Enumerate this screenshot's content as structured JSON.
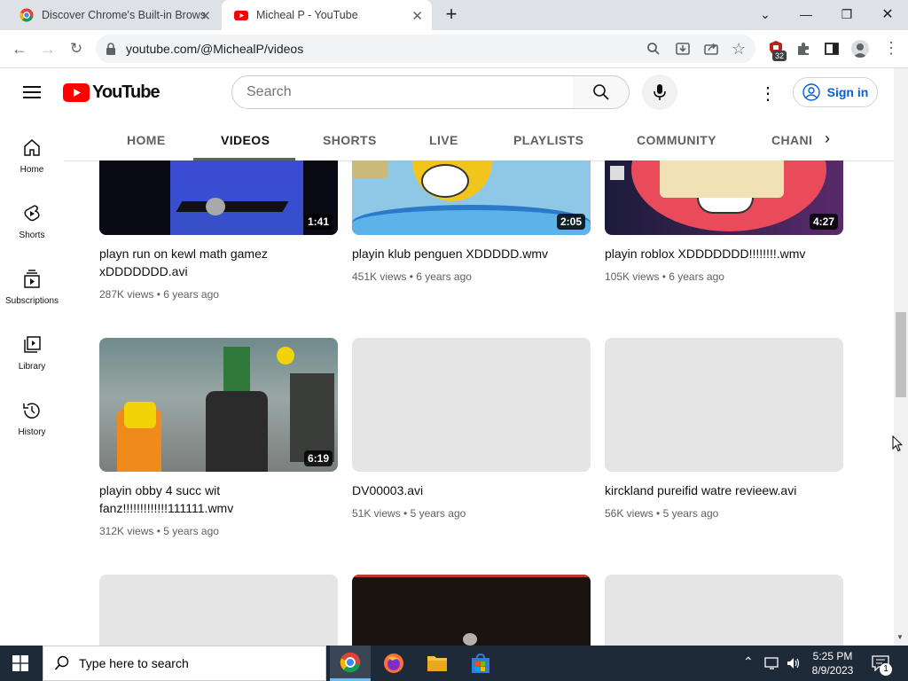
{
  "browser": {
    "tabs": [
      {
        "title": "Discover Chrome's Built-in Brows"
      },
      {
        "title": "Micheal P - YouTube"
      }
    ],
    "url": "youtube.com/@MichealP/videos",
    "extension_badge": "32"
  },
  "youtube": {
    "logo_text": "YouTube",
    "search_placeholder": "Search",
    "signin_label": "Sign in",
    "channel_tabs": [
      "HOME",
      "VIDEOS",
      "SHORTS",
      "LIVE",
      "PLAYLISTS",
      "COMMUNITY",
      "CHANI"
    ],
    "nav": [
      {
        "label": "Home",
        "icon": "home-icon"
      },
      {
        "label": "Shorts",
        "icon": "shorts-icon"
      },
      {
        "label": "Subscriptions",
        "icon": "subscriptions-icon"
      },
      {
        "label": "Library",
        "icon": "library-icon"
      },
      {
        "label": "History",
        "icon": "history-icon"
      }
    ],
    "videos": [
      {
        "title": "playn run on kewl math gamez xDDDDDDD.avi",
        "views": "287K views",
        "age": "6 years ago",
        "duration": "1:41"
      },
      {
        "title": "playin klub penguen XDDDDD.wmv",
        "views": "451K views",
        "age": "6 years ago",
        "duration": "2:05"
      },
      {
        "title": "playin roblox XDDDDDDD!!!!!!!!.wmv",
        "views": "105K views",
        "age": "6 years ago",
        "duration": "4:27"
      },
      {
        "title": "playin obby 4 succ wit fanz!!!!!!!!!!!!!111111.wmv",
        "views": "312K views",
        "age": "5 years ago",
        "duration": "6:19"
      },
      {
        "title": "DV00003.avi",
        "views": "51K views",
        "age": "5 years ago",
        "duration": ""
      },
      {
        "title": "kirckland pureifid watre revieew.avi",
        "views": "56K views",
        "age": "5 years ago",
        "duration": ""
      }
    ]
  },
  "taskbar": {
    "search_placeholder": "Type here to search",
    "time": "5:25 PM",
    "date": "8/9/2023",
    "notification_count": "1"
  },
  "colors": {
    "youtube_red": "#ff0000",
    "accent_blue": "#065fd4",
    "taskbar": "#1f2a38"
  }
}
